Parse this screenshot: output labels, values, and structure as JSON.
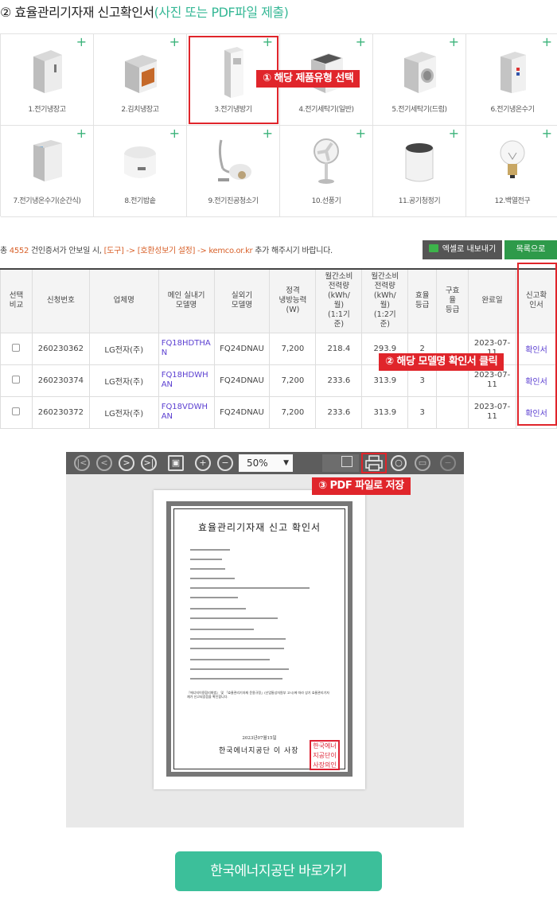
{
  "heading": {
    "step": "② 효율관리기자재 신고확인서",
    "note": "(사진 또는 PDF파일 제출)",
    "accent_color": "#36b896"
  },
  "products": [
    {
      "label": "1.전기냉장고",
      "icon": "refrigerator-icon"
    },
    {
      "label": "2.김치냉장고",
      "icon": "kimchi-refrigerator-icon"
    },
    {
      "label": "3.전기냉방기",
      "icon": "air-conditioner-icon",
      "selected": true
    },
    {
      "label": "4.전기세탁기(일반)",
      "icon": "washing-machine-top-icon"
    },
    {
      "label": "5.전기세탁기(드럼)",
      "icon": "washing-machine-drum-icon"
    },
    {
      "label": "6.전기냉온수기",
      "icon": "water-cooler-icon"
    },
    {
      "label": "7.전기냉온수기(순간식)",
      "icon": "instant-water-dispenser-icon"
    },
    {
      "label": "8.전기밥솥",
      "icon": "rice-cooker-icon"
    },
    {
      "label": "9.전기진공청소기",
      "icon": "vacuum-cleaner-icon"
    },
    {
      "label": "10.선풍기",
      "icon": "fan-icon"
    },
    {
      "label": "11.공기청정기",
      "icon": "air-purifier-icon"
    },
    {
      "label": "12.백열전구",
      "icon": "light-bulb-icon"
    }
  ],
  "callouts": {
    "step1": "① 해당 제품유형 선택",
    "step2": "② 해당 모델명 확인서 클릭",
    "step3": "③ PDF 파일로 저장",
    "color": "#e0252b"
  },
  "toolbar": {
    "total_prefix": "총",
    "total_count": "4552",
    "notice_1": "건인증서가 안보일 시,",
    "tools": "[도구]",
    "arrow1": "->",
    "compat": "[호환성보기 설정]",
    "arrow2": "->",
    "domain": "kemco.or.kr",
    "notice_2": "추가 해주시기 바랍니다.",
    "excel_label": "엑셀로 내보내기",
    "list_label": "목록으로"
  },
  "table": {
    "headers": [
      "선택\n비교",
      "신청번호",
      "업체명",
      "메인 실내기\n모델명",
      "실외기\n모델명",
      "정격\n냉방능력\n(W)",
      "월간소비\n전력량\n(kWh/\n월)\n(1:1기\n준)",
      "월간소비\n전력량\n(kWh/\n월)\n(1:2기\n준)",
      "효율\n등급",
      "구효\n율\n등급",
      "완료일",
      "신고확\n인서"
    ],
    "rows": [
      {
        "app_no": "260230362",
        "company": "LG전자(주)",
        "indoor": "FQ18HDTHAN",
        "outdoor": "FQ24DNAU",
        "capacity": "7,200",
        "power_11": "218.4",
        "power_12": "293.9",
        "grade": "2",
        "old_grade": "",
        "date": "2023-07-11",
        "cert": "확인서"
      },
      {
        "app_no": "260230374",
        "company": "LG전자(주)",
        "indoor": "FQ18HDWHAN",
        "outdoor": "FQ24DNAU",
        "capacity": "7,200",
        "power_11": "233.6",
        "power_12": "313.9",
        "grade": "3",
        "old_grade": "",
        "date": "2023-07-11",
        "cert": "확인서"
      },
      {
        "app_no": "260230372",
        "company": "LG전자(주)",
        "indoor": "FQ18VDWHAN",
        "outdoor": "FQ24DNAU",
        "capacity": "7,200",
        "power_11": "233.6",
        "power_12": "313.9",
        "grade": "3",
        "old_grade": "",
        "date": "2023-07-11",
        "cert": "확인서"
      }
    ]
  },
  "viewer": {
    "zoom": "50%",
    "cert_title": "효율관리기자재 신고 확인서",
    "cert_date": "2023년07월15일",
    "cert_org": "한국에너지공단  이  사장",
    "cert_seal": "한국에너지공단이사장의인",
    "cert_body": "『에너지이용합리화법』 및 「효율관리기자재 운용규정」(산업통상자원부 고시)에 따라 상기 효율관리기자재가 신고되었음을 확인합니다."
  },
  "cta": {
    "label": "한국에너지공단 바로가기",
    "color": "#3cbf9a"
  }
}
